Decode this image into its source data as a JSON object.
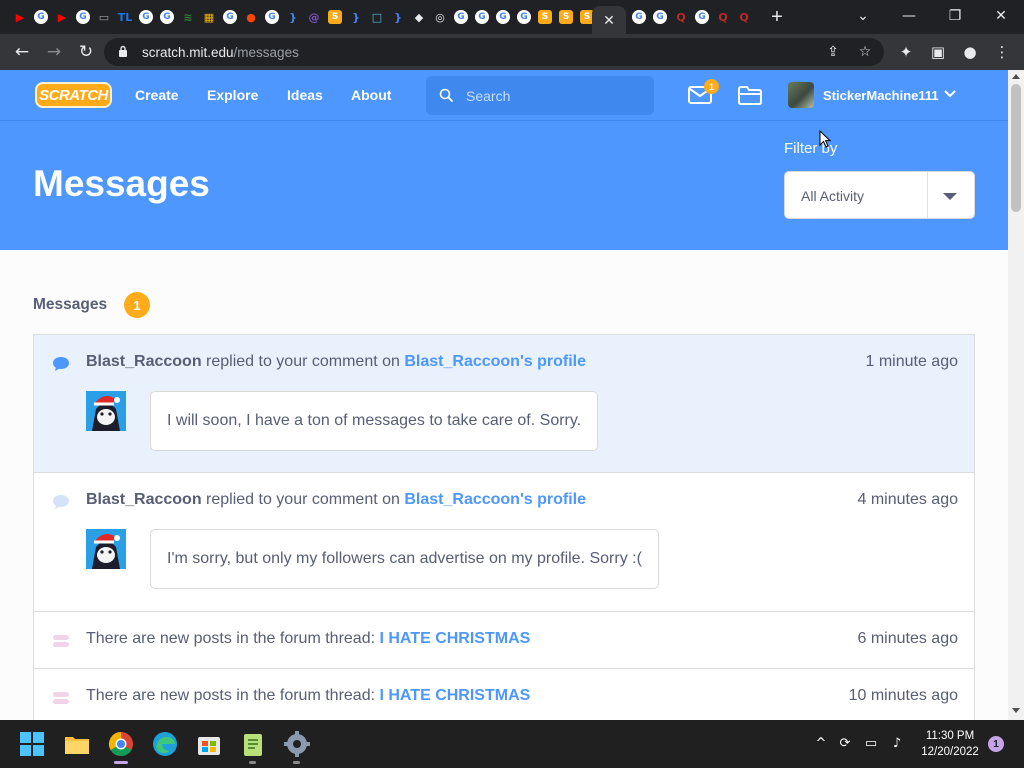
{
  "browser": {
    "tabs": [
      {
        "icon": "youtube-icon",
        "glyph": "▶",
        "color": "#ff0000"
      },
      {
        "icon": "google-icon",
        "glyph": "G",
        "color": "#ffffff"
      },
      {
        "icon": "youtube-icon",
        "glyph": "▶",
        "color": "#ff0000"
      },
      {
        "icon": "google-icon",
        "glyph": "G",
        "color": "#ffffff"
      },
      {
        "icon": "monitor-icon",
        "glyph": "▭",
        "color": "#9aa0a6"
      },
      {
        "icon": "tl-icon",
        "glyph": "TL",
        "color": "#1a73e8"
      },
      {
        "icon": "google-icon",
        "glyph": "G",
        "color": "#ffffff"
      },
      {
        "icon": "google-icon",
        "glyph": "G",
        "color": "#ffffff"
      },
      {
        "icon": "signal-icon",
        "glyph": "≋",
        "color": "#2e7d32"
      },
      {
        "icon": "app-icon",
        "glyph": "▦",
        "color": "#f4b400"
      },
      {
        "icon": "google-icon",
        "glyph": "G",
        "color": "#ffffff"
      },
      {
        "icon": "reddit-icon",
        "glyph": "●",
        "color": "#ff4500"
      },
      {
        "icon": "google-icon",
        "glyph": "G",
        "color": "#ffffff"
      },
      {
        "icon": "code-icon",
        "glyph": "}",
        "color": "#4285f4"
      },
      {
        "icon": "at-icon",
        "glyph": "@",
        "color": "#7e57c2"
      },
      {
        "icon": "scratch-tab-icon",
        "glyph": "S",
        "color": "#ffab19"
      },
      {
        "icon": "code-icon",
        "glyph": "}",
        "color": "#4285f4"
      },
      {
        "icon": "chat-icon",
        "glyph": "□",
        "color": "#4fc3f7"
      },
      {
        "icon": "code-icon",
        "glyph": "}",
        "color": "#4285f4"
      },
      {
        "icon": "roblox-icon",
        "glyph": "◆",
        "color": "#e8eaed"
      },
      {
        "icon": "chrome-icon",
        "glyph": "◎",
        "color": "#e8eaed"
      },
      {
        "icon": "google-icon",
        "glyph": "G",
        "color": "#ffffff"
      },
      {
        "icon": "google-icon",
        "glyph": "G",
        "color": "#ffffff"
      },
      {
        "icon": "google-icon",
        "glyph": "G",
        "color": "#ffffff"
      },
      {
        "icon": "google-icon",
        "glyph": "G",
        "color": "#ffffff"
      },
      {
        "icon": "scratch-tab-icon",
        "glyph": "S",
        "color": "#ffab19"
      },
      {
        "icon": "scratch-tab-icon",
        "glyph": "S",
        "color": "#ffab19"
      },
      {
        "icon": "scratch-tab-icon",
        "glyph": "S",
        "color": "#ffab19"
      },
      {
        "icon": "active-tab-close-icon",
        "glyph": "✕",
        "color": "#e8eaed",
        "active": true
      },
      {
        "icon": "google-icon",
        "glyph": "G",
        "color": "#ffffff"
      },
      {
        "icon": "google-icon",
        "glyph": "G",
        "color": "#ffffff"
      },
      {
        "icon": "quora-icon",
        "glyph": "Q",
        "color": "#b92b27"
      },
      {
        "icon": "google-icon",
        "glyph": "G",
        "color": "#ffffff"
      },
      {
        "icon": "quora-icon",
        "glyph": "Q",
        "color": "#b92b27"
      },
      {
        "icon": "quora-icon",
        "glyph": "Q",
        "color": "#b92b27"
      }
    ],
    "new_tab_label": "+",
    "url_host": "scratch.mit.edu",
    "url_path": "/messages"
  },
  "scratch": {
    "logo_text": "SCRATCH",
    "nav": {
      "create": "Create",
      "explore": "Explore",
      "ideas": "Ideas",
      "about": "About"
    },
    "search_placeholder": "Search",
    "message_badge": "1",
    "username": "StickerMachine111",
    "accent": "#4d97ff",
    "badge_color": "#ffab1a"
  },
  "banner": {
    "title": "Messages",
    "filter_label": "Filter by",
    "filter_value": "All Activity"
  },
  "messages": {
    "section_title": "Messages",
    "count": "1",
    "items": [
      {
        "actor": "Blast_Raccoon",
        "action": " replied to your comment on ",
        "target": "Blast_Raccoon's profile",
        "time": "1 minute ago",
        "comment": "I will soon, I have a ton of messages to take care of. Sorry."
      },
      {
        "actor": "Blast_Raccoon",
        "action": " replied to your comment on ",
        "target": "Blast_Raccoon's profile",
        "time": "4 minutes ago",
        "comment": "I'm sorry, but only my followers can advertise on my profile. Sorry :("
      },
      {
        "action": "There are new posts in the forum thread: ",
        "target": "I HATE CHRISTMAS",
        "time": "6 minutes ago"
      },
      {
        "action": "There are new posts in the forum thread: ",
        "target": "I HATE CHRISTMAS",
        "time": "10 minutes ago"
      }
    ]
  },
  "taskbar": {
    "time": "11:30 PM",
    "date": "12/20/2022",
    "notification_count": "1"
  }
}
